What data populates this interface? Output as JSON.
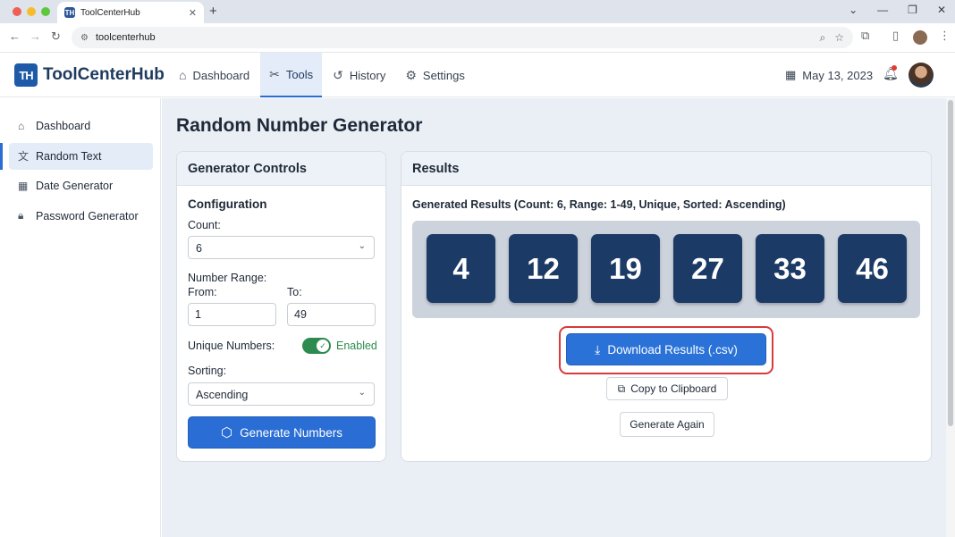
{
  "browser": {
    "tab_title": "ToolCenterHub",
    "favicon_text": "TH",
    "url": "toolcenterhub",
    "icons": [
      "back-icon",
      "forward-icon",
      "reload-icon",
      "zoom-icon",
      "star-icon",
      "extensions-icon",
      "sidepanel-icon",
      "profile-avatar",
      "menu-icon"
    ]
  },
  "header": {
    "logo_mark": "TH",
    "logo_text": "ToolCenterHub",
    "nav": [
      {
        "label": "Dashboard",
        "icon": "home-icon",
        "active": false
      },
      {
        "label": "Tools",
        "icon": "tools-icon",
        "active": true
      },
      {
        "label": "History",
        "icon": "history-icon",
        "active": false
      },
      {
        "label": "Settings",
        "icon": "gear-icon",
        "active": false
      }
    ],
    "date": "May 13, 2023"
  },
  "sidebar": {
    "items": [
      {
        "label": "Dashboard",
        "icon": "home-icon",
        "active": false
      },
      {
        "label": "Random Text",
        "icon": "translate-icon",
        "active": true
      },
      {
        "label": "Date Generator",
        "icon": "calendar-icon",
        "active": false
      },
      {
        "label": "Password Generator",
        "icon": "lock-icon",
        "active": false
      }
    ]
  },
  "main": {
    "page_title": "Random Number Generator",
    "controls": {
      "title": "Generator Controls",
      "configuration_label": "Configuration",
      "count_label": "Count:",
      "count_value": "6",
      "range_label": "Number Range:",
      "from_label": "From:",
      "from_value": "1",
      "to_label": "To:",
      "to_value": "49",
      "unique_label": "Unique Numbers:",
      "unique_state": "Enabled",
      "unique_enabled": true,
      "sorting_label": "Sorting:",
      "sorting_value": "Ascending",
      "generate_label": "Generate Numbers"
    },
    "results": {
      "title": "Results",
      "summary": "Generated Results (Count: 6, Range: 1-49, Unique, Sorted: Ascending)",
      "numbers": [
        "4",
        "12",
        "19",
        "27",
        "33",
        "46"
      ],
      "download_label": "Download Results (.csv)",
      "copy_label": "Copy to Clipboard",
      "again_label": "Generate Again"
    }
  },
  "colors": {
    "primary": "#2a6dd4",
    "ball": "#1c3a66",
    "toggle_on": "#2e8b4f",
    "highlight": "#d93a3a"
  }
}
